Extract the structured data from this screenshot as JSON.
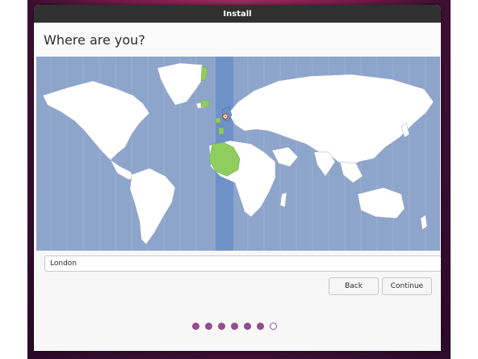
{
  "window": {
    "title": "Install"
  },
  "page": {
    "heading": "Where are you?"
  },
  "location": {
    "value": "London",
    "selected_city": "London"
  },
  "buttons": {
    "back": "Back",
    "continue": "Continue"
  },
  "progress": {
    "total_steps": 7,
    "completed_steps": 6
  },
  "colors": {
    "map_ocean": "#8ea5cb",
    "map_land": "#ffffff",
    "timezone_band": "#6e91c8",
    "timezone_land": "#8fcd5f",
    "accent_purple": "#924d8b",
    "titlebar": "#303030"
  }
}
